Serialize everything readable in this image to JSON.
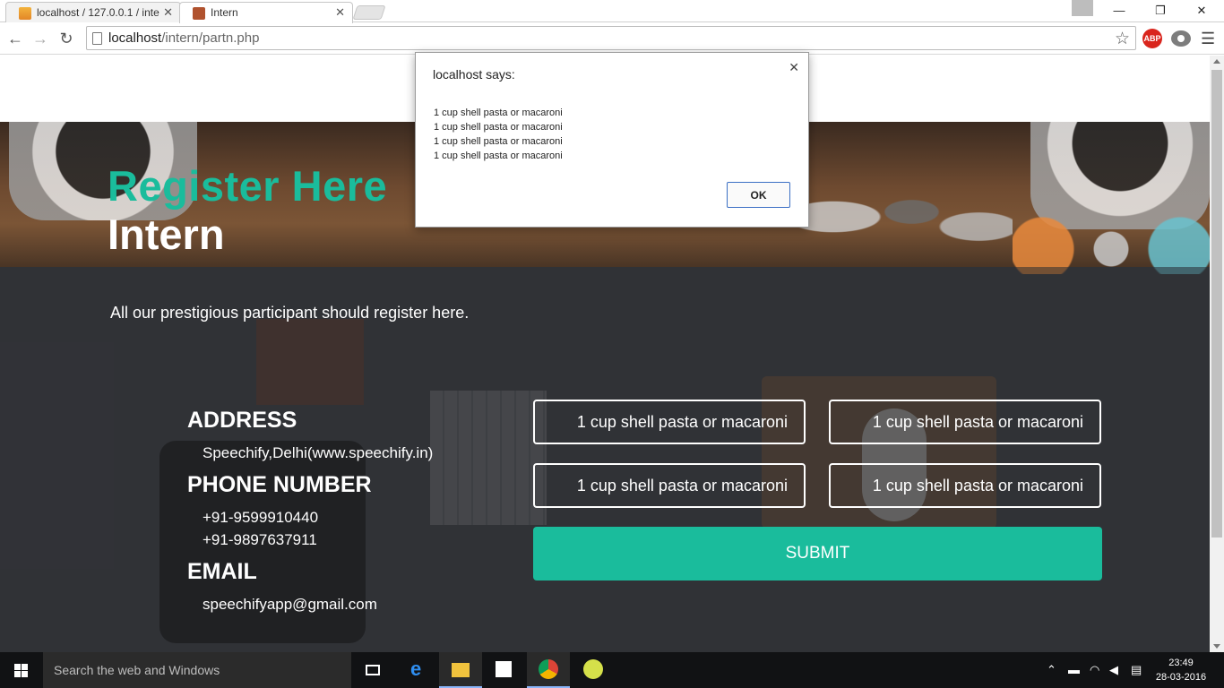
{
  "browser": {
    "tabs": [
      {
        "label": "localhost / 127.0.0.1 / inte",
        "active": false
      },
      {
        "label": "Intern",
        "active": true
      }
    ],
    "url_host": "localhost",
    "url_path": "/intern/partn.php",
    "extensions": {
      "abp_label": "ABP"
    }
  },
  "page": {
    "title_green": "Register Here",
    "title_white": "Intern",
    "tagline": "All our prestigious participant should register here.",
    "info": {
      "address_heading": "ADDRESS",
      "address": "Speechify,Delhi(www.speechify.in)",
      "phone_heading": "PHONE NUMBER",
      "phones": [
        "+91-9599910440",
        "+91-9897637911"
      ],
      "email_heading": "EMAIL",
      "email": "speechifyapp@gmail.com"
    },
    "form": {
      "fields": [
        "1 cup shell pasta or macaroni",
        "1 cup shell pasta or macaroni",
        "1 cup shell pasta or macaroni",
        "1 cup shell pasta or macaroni"
      ],
      "submit_label": "SUBMIT"
    },
    "colors": {
      "accent": "#1abc9c"
    }
  },
  "dialog": {
    "title": "localhost says:",
    "lines": [
      "1 cup shell pasta or macaroni",
      "1 cup shell pasta or macaroni",
      "1 cup shell pasta or macaroni",
      "1 cup shell pasta or macaroni"
    ],
    "ok_label": "OK"
  },
  "taskbar": {
    "search_placeholder": "Search the web and Windows",
    "icons": [
      "task-view-icon",
      "edge-icon",
      "file-explorer-icon",
      "store-icon",
      "chrome-icon",
      "app-icon"
    ],
    "time": "23:49",
    "date": "28-03-2016"
  }
}
